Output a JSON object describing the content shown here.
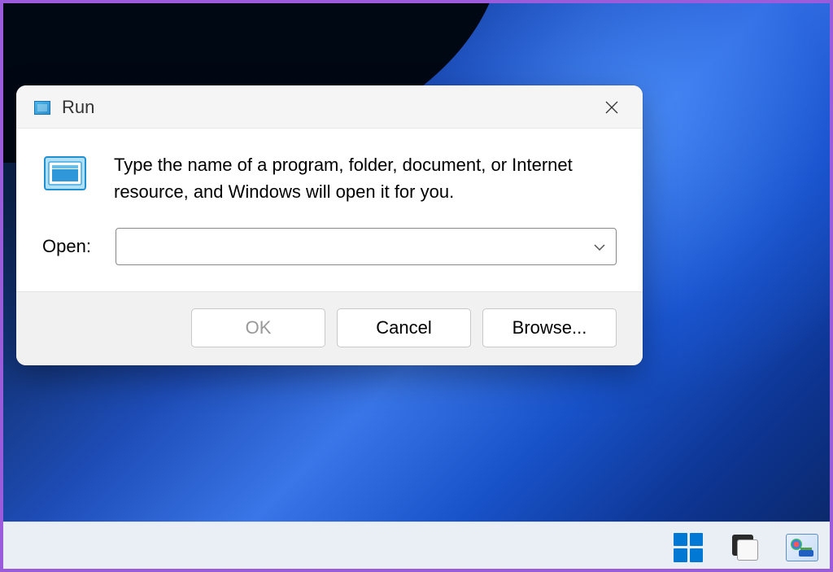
{
  "dialog": {
    "title": "Run",
    "description": "Type the name of a program, folder, document, or Internet resource, and Windows will open it for you.",
    "open_label": "Open:",
    "input_value": "",
    "buttons": {
      "ok": "OK",
      "cancel": "Cancel",
      "browse": "Browse..."
    }
  }
}
